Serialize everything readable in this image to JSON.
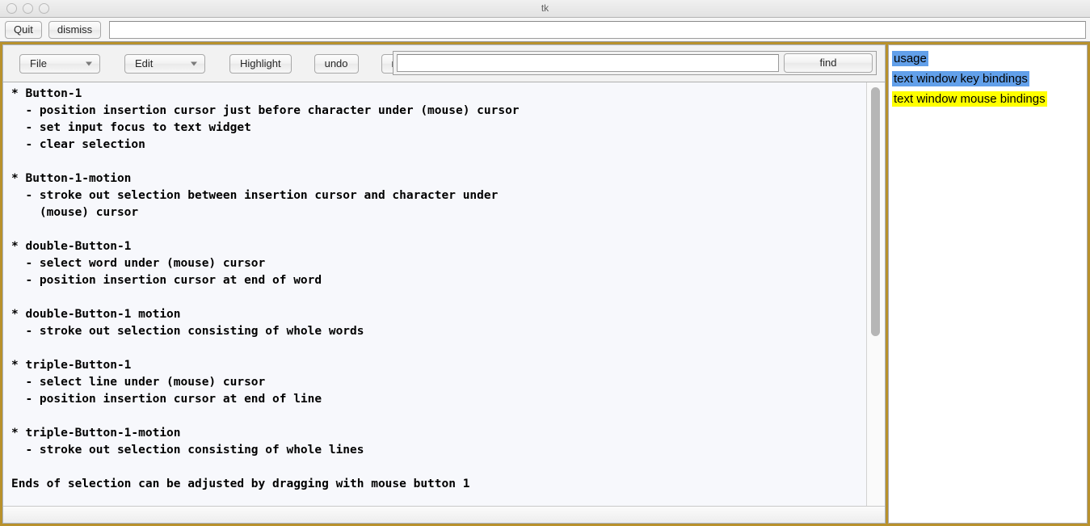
{
  "window": {
    "title": "tk",
    "controls": [
      "close-dot",
      "minimize-dot",
      "zoom-dot"
    ]
  },
  "topbar": {
    "quit_label": "Quit",
    "dismiss_label": "dismiss",
    "entry_value": "",
    "entry_placeholder": ""
  },
  "toolbar": {
    "file_label": "File",
    "edit_label": "Edit",
    "highlight_label": "Highlight",
    "undo_label": "undo",
    "redo_label": "redo",
    "find_label": "find",
    "find_value": "",
    "find_placeholder": ""
  },
  "main": {
    "text": "* Button-1\n  - position insertion cursor just before character under (mouse) cursor\n  - set input focus to text widget\n  - clear selection\n\n* Button-1-motion\n  - stroke out selection between insertion cursor and character under\n    (mouse) cursor\n\n* double-Button-1\n  - select word under (mouse) cursor\n  - position insertion cursor at end of word\n\n* double-Button-1 motion\n  - stroke out selection consisting of whole words\n\n* triple-Button-1\n  - select line under (mouse) cursor\n  - position insertion cursor at end of line\n\n* triple-Button-1-motion\n  - stroke out selection consisting of whole lines\n\nEnds of selection can be adjusted by dragging with mouse button 1"
  },
  "sidebar": {
    "items": [
      {
        "label": "usage",
        "highlight": "blue"
      },
      {
        "label": "text window key bindings",
        "highlight": "blue"
      },
      {
        "label": "text window mouse bindings",
        "highlight": "yellow"
      }
    ]
  },
  "colors": {
    "frame": "#b8912c",
    "highlight_blue": "#62a0ea",
    "highlight_yellow": "#ffff00",
    "text_bg": "#f7f8fc"
  }
}
